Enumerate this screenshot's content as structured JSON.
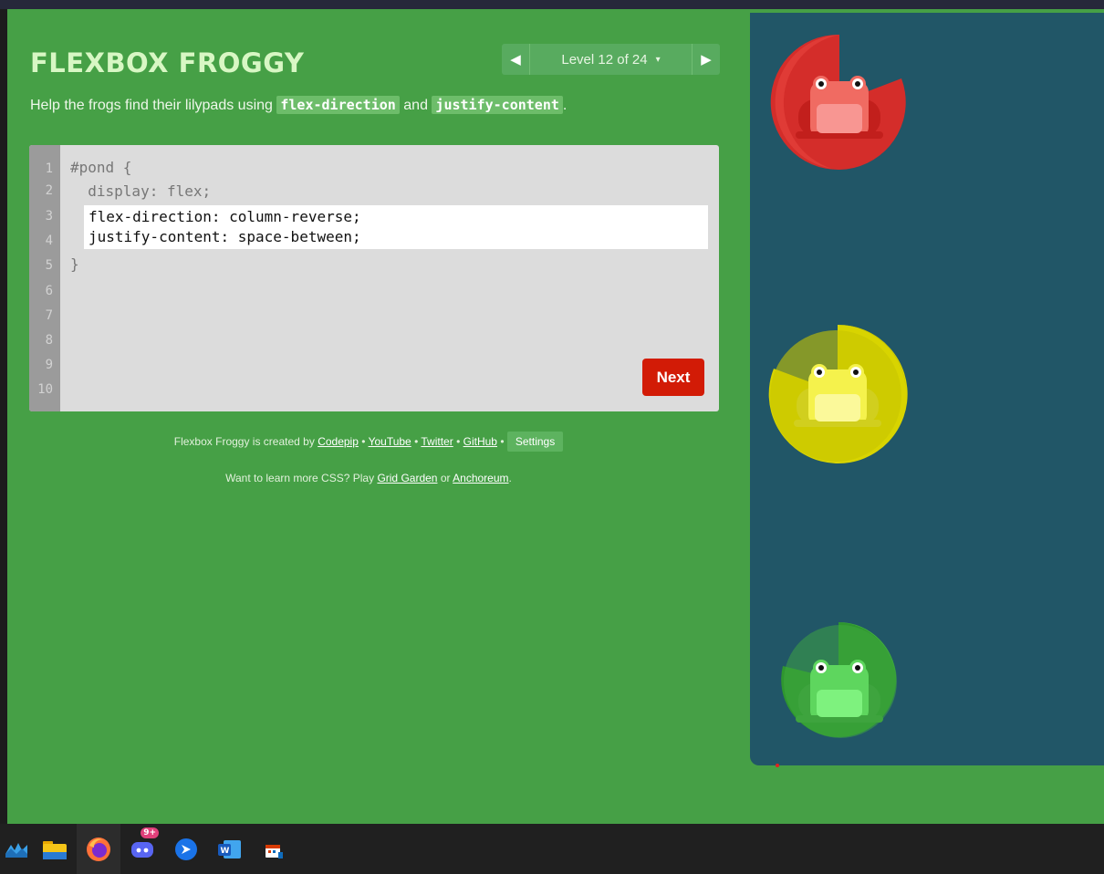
{
  "app": {
    "title": "FLEXBOX FROGGY",
    "instructions_prefix": "Help the frogs find their lilypads using",
    "instructions_term1": "flex-direction",
    "instructions_and": "and",
    "instructions_term2": "justify-content",
    "instructions_suffix": "."
  },
  "level_nav": {
    "prev_label": "◀",
    "next_label": "▶",
    "level_text": "Level 12 of 24",
    "caret": "▾"
  },
  "editor": {
    "line_numbers": [
      "1",
      "2",
      "3",
      "4",
      "5",
      "6",
      "7",
      "8",
      "9",
      "10"
    ],
    "line1": "#pond {",
    "line2": "  display: flex;",
    "user_input": "flex-direction: column-reverse;\njustify-content: space-between;",
    "line5": "}",
    "next_label": "Next"
  },
  "footer": {
    "created_by": "Flexbox Froggy is created by",
    "codepip": "Codepip",
    "sep": "•",
    "youtube": "YouTube",
    "twitter": "Twitter",
    "github": "GitHub",
    "settings": "Settings",
    "learn_prefix": "Want to learn more CSS? Play",
    "grid_garden": "Grid Garden",
    "or": "or",
    "anchoreum": "Anchoreum",
    "learn_suffix": "."
  },
  "pond": {
    "colors": {
      "water": "#215667",
      "red": "#d42d2a",
      "yellow": "#d8d400",
      "green": "#2f962f"
    }
  },
  "taskbar": {
    "icons": [
      "weather-icon",
      "file-explorer-icon",
      "firefox-icon",
      "discord-icon",
      "app-icon",
      "word-icon",
      "calendar-app-icon"
    ],
    "discord_badge": "9+"
  }
}
